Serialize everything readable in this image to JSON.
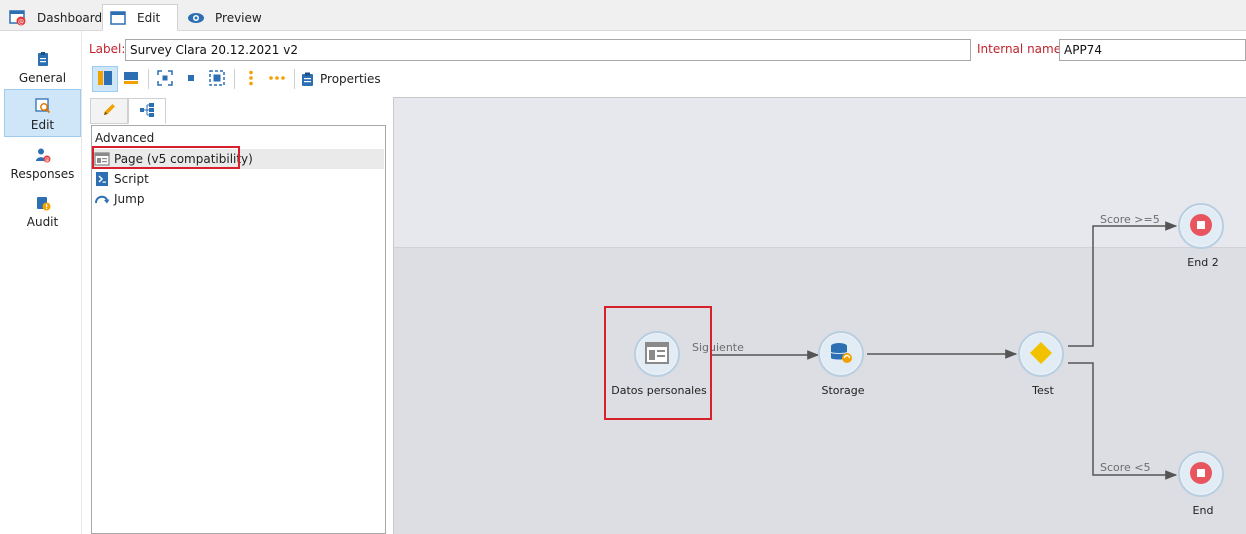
{
  "tabs": [
    {
      "label": "Dashboard",
      "icon": "dashboard-icon",
      "active": false
    },
    {
      "label": "Edit",
      "icon": "edit-window-icon",
      "active": true
    },
    {
      "label": "Preview",
      "icon": "eye-icon",
      "active": false
    }
  ],
  "nav": [
    {
      "label": "General",
      "icon": "general-icon",
      "active": false
    },
    {
      "label": "Edit",
      "icon": "edit-search-icon",
      "active": true
    },
    {
      "label": "Responses",
      "icon": "responses-icon",
      "active": false
    },
    {
      "label": "Audit",
      "icon": "audit-icon",
      "active": false
    }
  ],
  "form": {
    "label_caption": "Label:",
    "label_value": "Survey Clara 20.12.2021 v2",
    "internal_caption": "Internal name:",
    "internal_value": "APP74"
  },
  "toolbar": {
    "properties_label": "Properties"
  },
  "palette": {
    "group": "Advanced",
    "items": [
      {
        "label": "Page (v5 compatibility)",
        "icon": "page-icon"
      },
      {
        "label": "Script",
        "icon": "script-icon"
      },
      {
        "label": "Jump",
        "icon": "jump-icon"
      }
    ]
  },
  "workflow": {
    "nodes": [
      {
        "id": "datos",
        "label": "Datos personales",
        "icon": "page-icon"
      },
      {
        "id": "storage",
        "label": "Storage",
        "icon": "database-icon"
      },
      {
        "id": "test",
        "label": "Test",
        "icon": "diamond-icon"
      },
      {
        "id": "end2",
        "label": "End 2",
        "icon": "stop-icon"
      },
      {
        "id": "end",
        "label": "End",
        "icon": "stop-icon"
      }
    ],
    "edges": [
      {
        "from": "datos",
        "to": "storage",
        "label": "Siguiente"
      },
      {
        "from": "storage",
        "to": "test",
        "label": ""
      },
      {
        "from": "test",
        "to": "end2",
        "label": "Score >=5"
      },
      {
        "from": "test",
        "to": "end",
        "label": "Score <5"
      }
    ]
  },
  "colors": {
    "accent_red": "#d6202b",
    "label_red": "#c0232c",
    "selection_blue": "#cfe6f8",
    "node_fill": "#e2ecf4",
    "stop_red": "#e8555e",
    "diamond_yellow": "#f2c100"
  }
}
